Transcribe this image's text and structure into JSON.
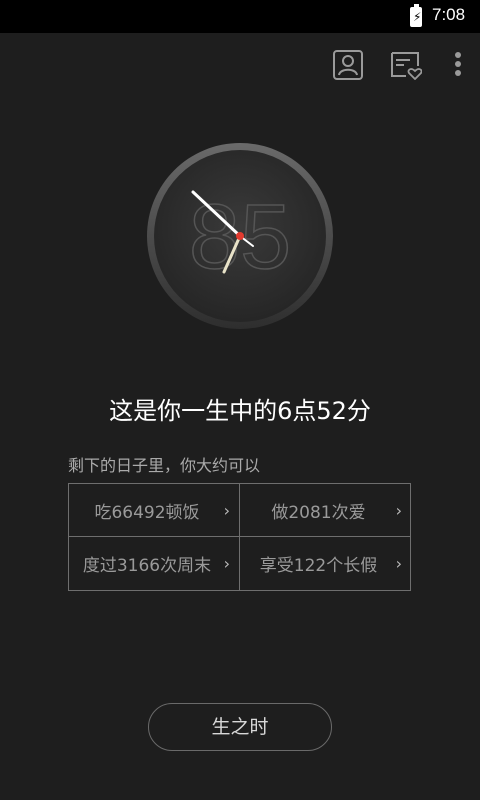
{
  "statusbar": {
    "time": "7:08",
    "battery_icon": "battery-charging-icon"
  },
  "toolbar": {
    "profile_icon": "person-card-icon",
    "favorites_icon": "message-heart-icon",
    "more_icon": "more-vertical-icon"
  },
  "clock": {
    "background_number": "85",
    "hour_hand_time": "6:52",
    "accent_color": "#e23a2f"
  },
  "headline": "这是你一生中的6点52分",
  "subtitle": "剩下的日子里，你大约可以",
  "stats": [
    {
      "label": "吃66492顿饭"
    },
    {
      "label": "做2081次爱"
    },
    {
      "label": "度过3166次周末"
    },
    {
      "label": "享受122个长假"
    }
  ],
  "bottom_button": {
    "label": "生之时"
  }
}
